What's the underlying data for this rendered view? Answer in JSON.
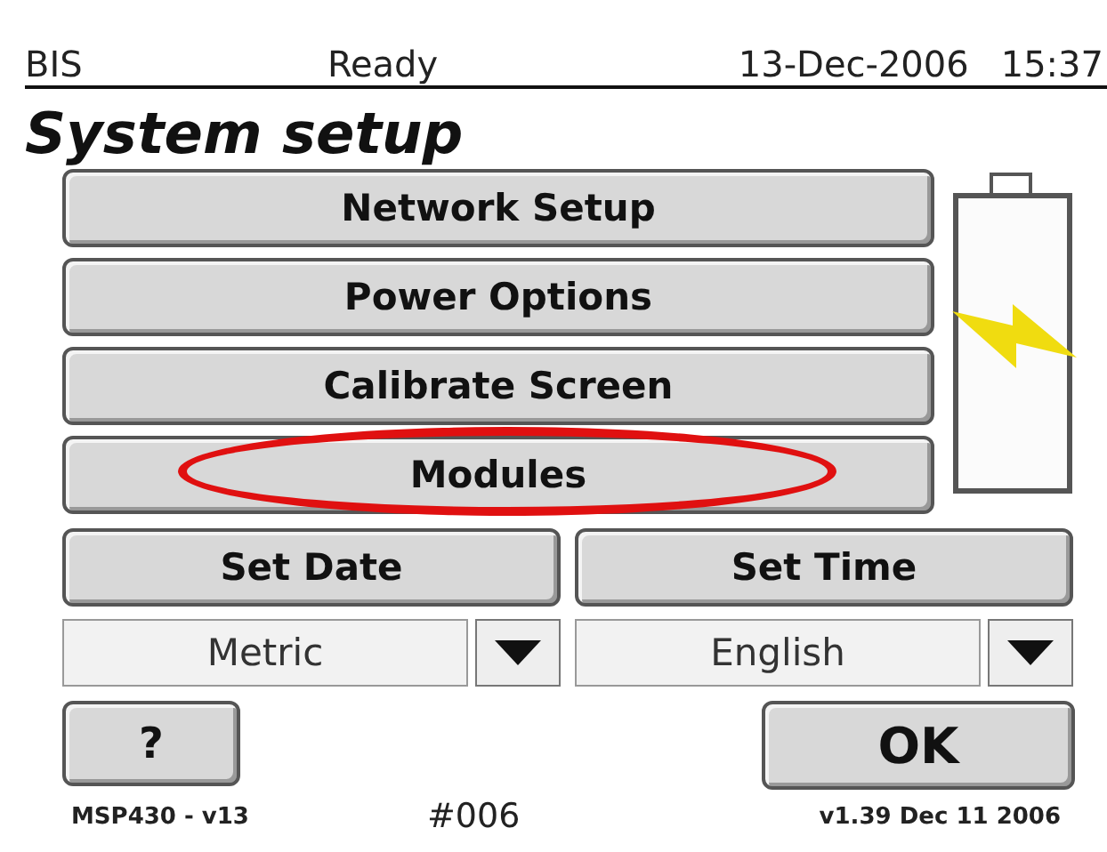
{
  "status_bar": {
    "app": "BIS",
    "state": "Ready",
    "date": "13-Dec-2006",
    "time": "15:37"
  },
  "title": "System setup",
  "menu": [
    {
      "label": "Network Setup",
      "highlighted": false
    },
    {
      "label": "Power Options",
      "highlighted": false
    },
    {
      "label": "Calibrate Screen",
      "highlighted": false
    },
    {
      "label": "Modules",
      "highlighted": true
    }
  ],
  "battery": {
    "charging": true
  },
  "date_time_buttons": [
    "Set Date",
    "Set Time"
  ],
  "dropdowns": [
    {
      "value": "Metric"
    },
    {
      "value": "English"
    }
  ],
  "help_button": "?",
  "ok_button": "OK",
  "footer": {
    "model": "MSP430 - v13",
    "number": "#006",
    "version": "v1.39 Dec 11 2006"
  }
}
